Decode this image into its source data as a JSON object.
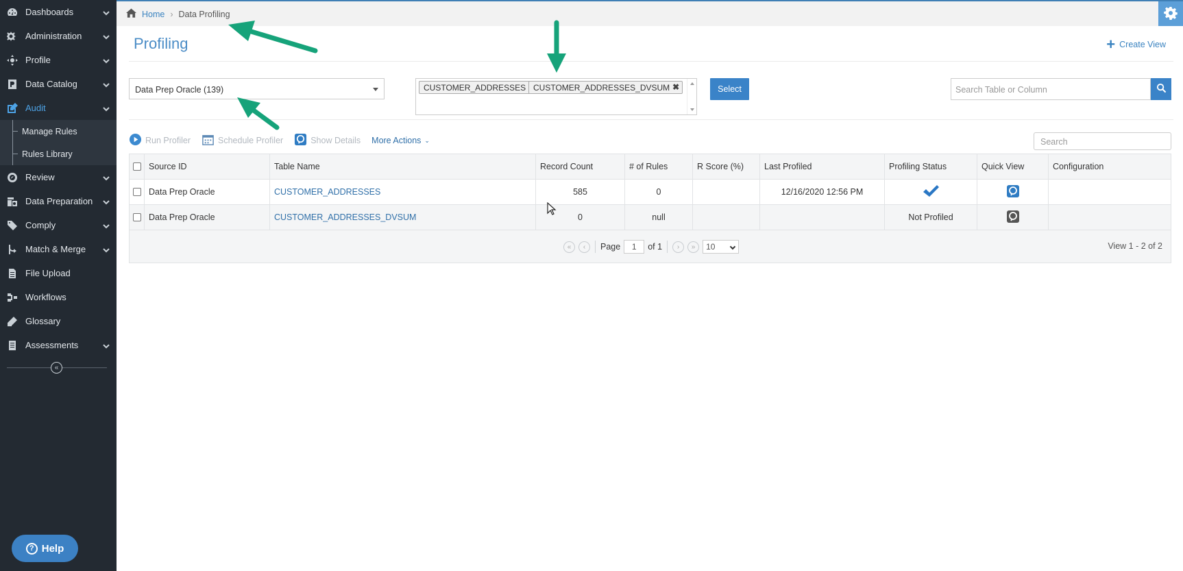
{
  "sidebar": {
    "items": [
      {
        "label": "Dashboards",
        "icon": "dashboard-icon",
        "has_chevron": true
      },
      {
        "label": "Administration",
        "icon": "cogs-icon",
        "has_chevron": true
      },
      {
        "label": "Profile",
        "icon": "profile-icon",
        "has_chevron": true
      },
      {
        "label": "Data Catalog",
        "icon": "catalog-icon",
        "has_chevron": true
      },
      {
        "label": "Audit",
        "icon": "edit-icon",
        "has_chevron": true,
        "active": true
      },
      {
        "label": "Review",
        "icon": "review-icon",
        "has_chevron": true
      },
      {
        "label": "Data Preparation",
        "icon": "data-preparation-icon",
        "has_chevron": true
      },
      {
        "label": "Comply",
        "icon": "tag-icon",
        "has_chevron": true
      },
      {
        "label": "Match & Merge",
        "icon": "merge-icon",
        "has_chevron": true
      },
      {
        "label": "File Upload",
        "icon": "file-icon",
        "has_chevron": false
      },
      {
        "label": "Workflows",
        "icon": "workflow-icon",
        "has_chevron": false
      },
      {
        "label": "Glossary",
        "icon": "glossary-icon",
        "has_chevron": false
      },
      {
        "label": "Assessments",
        "icon": "assessment-icon",
        "has_chevron": true
      }
    ],
    "audit_sub_items": [
      "Manage Rules",
      "Rules Library"
    ],
    "help_label": "Help"
  },
  "breadcrumb": {
    "home": "Home",
    "current": "Data Profiling"
  },
  "page": {
    "title": "Profiling",
    "create_view": "Create View"
  },
  "filters": {
    "source": "Data Prep Oracle (139)",
    "selected_tables": [
      "CUSTOMER_ADDRESSES",
      "CUSTOMER_ADDRESSES_DVSUM"
    ],
    "select_button": "Select",
    "search_placeholder": "Search Table or Column"
  },
  "toolbar": {
    "run_profiler": "Run Profiler",
    "schedule_profiler": "Schedule Profiler",
    "show_details": "Show Details",
    "more_actions": "More Actions",
    "grid_search_placeholder": "Search"
  },
  "grid": {
    "columns": [
      "Source ID",
      "Table Name",
      "Record Count",
      "# of Rules",
      "R Score (%)",
      "Last Profiled",
      "Profiling Status",
      "Quick View",
      "Configuration"
    ],
    "rows": [
      {
        "source_id": "Data Prep Oracle",
        "table_name": "CUSTOMER_ADDRESSES",
        "record_count": "585",
        "rules": "0",
        "r_score": "",
        "last_profiled": "12/16/2020 12:56 PM",
        "status": "profiled",
        "status_text": "",
        "configuration": ""
      },
      {
        "source_id": "Data Prep Oracle",
        "table_name": "CUSTOMER_ADDRESSES_DVSUM",
        "record_count": "0",
        "rules": "null",
        "r_score": "",
        "last_profiled": "",
        "status": "not_profiled",
        "status_text": "Not Profiled",
        "configuration": ""
      }
    ]
  },
  "pager": {
    "page_label": "Page",
    "page": "1",
    "of_label": "of 1",
    "page_size": "10",
    "view_count": "View 1 - 2 of 2"
  },
  "colors": {
    "sidebar_bg": "#232a32",
    "accent": "#3a83c8",
    "link": "#2f6fa8",
    "annotation_arrow": "#16a37a"
  }
}
